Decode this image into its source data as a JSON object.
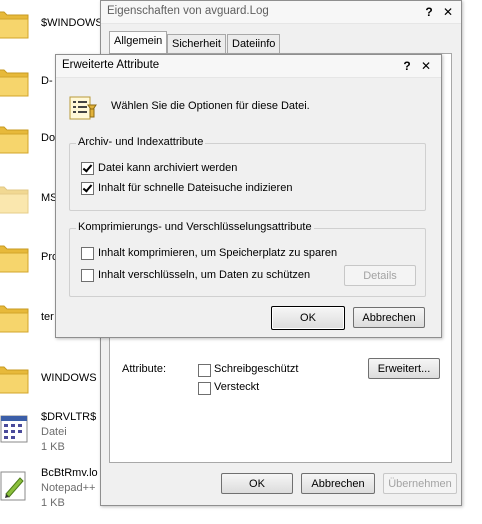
{
  "explorer": {
    "folders": [
      {
        "label": "$WINDOWS"
      },
      {
        "label": "D-"
      },
      {
        "label": "Do"
      },
      {
        "label": "MS"
      },
      {
        "label": "Pro"
      },
      {
        "label": "ter"
      },
      {
        "label": "WINDOWS"
      }
    ],
    "files": [
      {
        "name": "$DRVLTR$",
        "type": "Datei",
        "size": "1 KB"
      },
      {
        "name": "BcBtRmv.lo",
        "type": "Notepad++",
        "size": "1 KB"
      }
    ]
  },
  "properties_dialog": {
    "title": "Eigenschaften von avguard.Log",
    "help_glyph": "?",
    "close_glyph": "✕",
    "tabs": [
      {
        "label": "Allgemein"
      },
      {
        "label": "Sicherheit"
      },
      {
        "label": "Dateiinfo"
      }
    ],
    "attributes_label": "Attribute:",
    "readonly_label": "Schreibgeschützt",
    "hidden_label": "Versteckt",
    "advanced_button": "Erweitert...",
    "ok_button": "OK",
    "cancel_button": "Abbrechen",
    "apply_button": "Übernehmen"
  },
  "advanced_dialog": {
    "title": "Erweiterte Attribute",
    "help_glyph": "?",
    "close_glyph": "✕",
    "intro": "Wählen Sie die Optionen für diese Datei.",
    "archive_group": {
      "title": "Archiv- und Indexattribute",
      "archive_label": "Datei kann archiviert werden",
      "archive_checked": true,
      "index_label": "Inhalt für schnelle Dateisuche indizieren",
      "index_checked": true
    },
    "compress_group": {
      "title": "Komprimierungs- und Verschlüsselungsattribute",
      "compress_label": "Inhalt komprimieren, um Speicherplatz zu sparen",
      "compress_checked": false,
      "encrypt_label": "Inhalt verschlüsseln, um Daten zu schützen",
      "encrypt_checked": false,
      "details_button": "Details"
    },
    "ok_button": "OK",
    "cancel_button": "Abbrechen"
  },
  "colors": {
    "folder_yellow": "#f3cf5a",
    "dialog_bg": "#f0f0f0",
    "default_button_border": "#3c7fb1"
  }
}
